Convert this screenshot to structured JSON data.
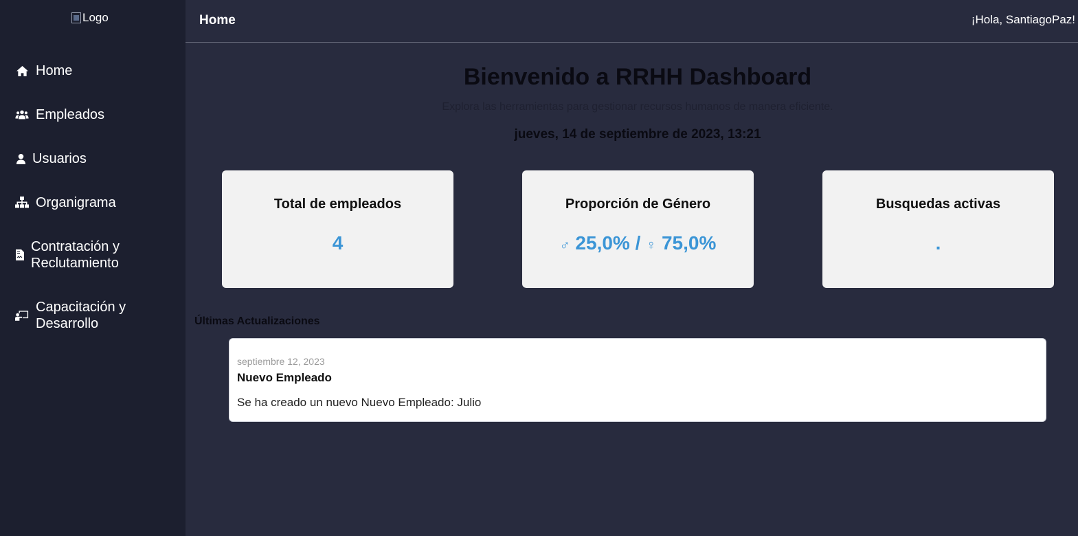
{
  "sidebar": {
    "logo_alt": "Logo",
    "items": [
      {
        "label": "Home",
        "icon": "home-icon"
      },
      {
        "label": "Empleados",
        "icon": "users-icon"
      },
      {
        "label": "Usuarios",
        "icon": "user-icon"
      },
      {
        "label": "Organigrama",
        "icon": "sitemap-icon"
      },
      {
        "label": "Contratación y",
        "label2": "Reclutamiento",
        "icon": "file-contract-icon"
      },
      {
        "label": "Capacitación y",
        "label2": "Desarrollo",
        "icon": "chalkboard-teacher-icon"
      }
    ]
  },
  "header": {
    "title": "Home",
    "greeting": "¡Hola, SantiagoPaz!"
  },
  "welcome": {
    "title": "Bienvenido a RRHH Dashboard",
    "subtitle": "Explora las herramientas para gestionar recursos humanos de manera eficiente.",
    "datetime": "jueves, 14 de septiembre de 2023, 13:21"
  },
  "cards": [
    {
      "title": "Total de empleados",
      "value": "4"
    },
    {
      "title": "Proporción de Género",
      "male_symbol": "♂",
      "male": "25,0%",
      "separator": "/",
      "female_symbol": "♀",
      "female": "75,0%"
    },
    {
      "title": "Busquedas activas",
      "value": "."
    }
  ],
  "updates": {
    "heading": "Últimas Actualizaciones",
    "items": [
      {
        "date": "septiembre 12, 2023",
        "title": "Nuevo Empleado",
        "body": "Se ha creado un nuevo Nuevo Empleado: Julio"
      }
    ]
  },
  "colors": {
    "sidebar_bg": "#1c1f2f",
    "main_bg": "#282b3e",
    "card_bg": "#f2f2f2",
    "accent": "#3b95d6"
  }
}
